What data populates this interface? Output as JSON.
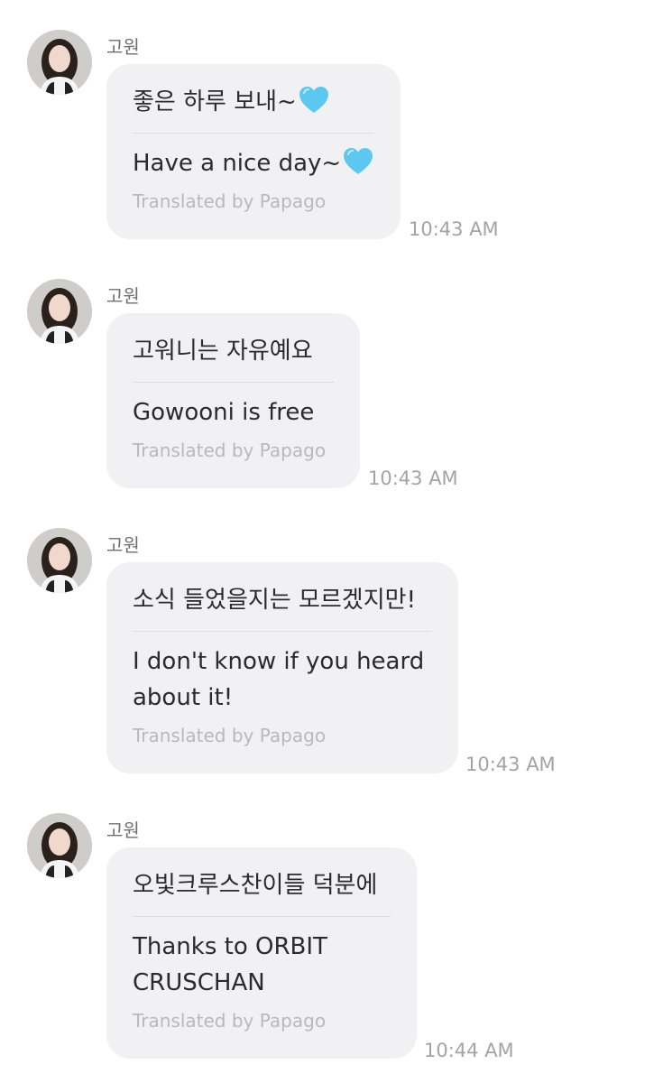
{
  "messages": [
    {
      "sender": "고원",
      "original": "좋은 하루 보내~",
      "original_heart": true,
      "translation_lines": [
        "Have a nice day~"
      ],
      "translation_heart": true,
      "credit": "Translated by Papago",
      "time": "10:43 AM"
    },
    {
      "sender": "고원",
      "original": "고워니는 자유예요",
      "original_heart": false,
      "translation_lines": [
        "Gowooni is free"
      ],
      "translation_heart": false,
      "credit": "Translated by Papago",
      "time": "10:43 AM"
    },
    {
      "sender": "고원",
      "original": "소식 들었을지는 모르겠지만!",
      "original_heart": false,
      "translation_lines": [
        "I don't know if you heard",
        "about it!"
      ],
      "translation_heart": false,
      "credit": "Translated by Papago",
      "time": "10:43 AM"
    },
    {
      "sender": "고원",
      "original": "오빛크루스찬이들 덕분에",
      "original_heart": false,
      "translation_lines": [
        "Thanks to ORBIT",
        "CRUSCHAN"
      ],
      "translation_heart": false,
      "credit": "Translated by Papago",
      "time": "10:44 AM"
    }
  ],
  "colors": {
    "bubble": "#f1f1f3",
    "heart": "#5cc8f0",
    "muted_text": "#b9b9bd",
    "timestamp": "#a3a3a8"
  },
  "icons": {
    "avatar": "profile-photo",
    "emoji": "light-blue-heart-icon"
  }
}
